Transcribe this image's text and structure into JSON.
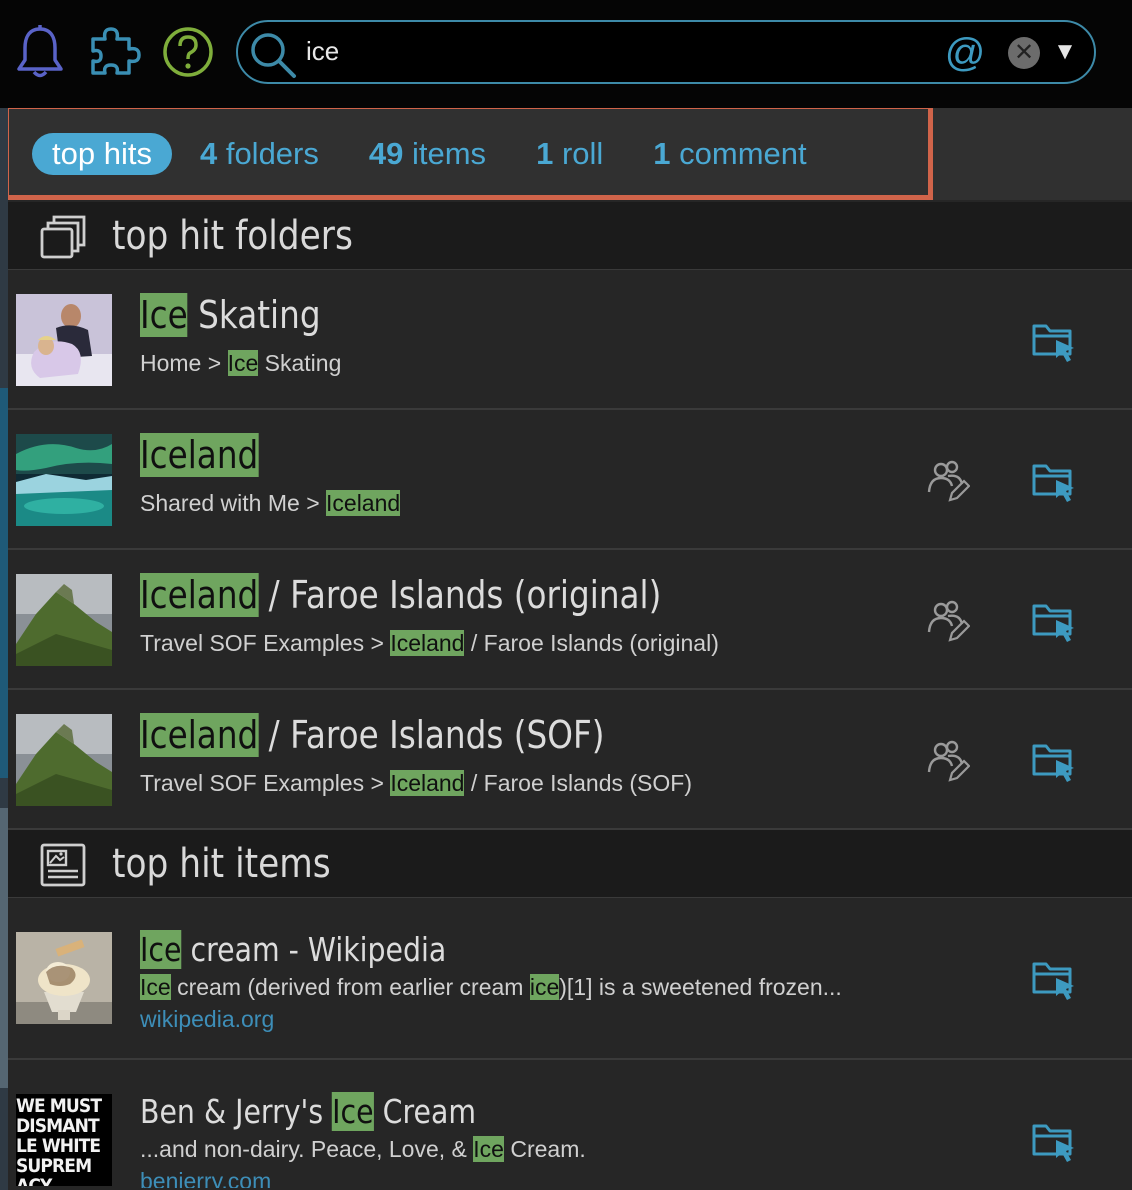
{
  "toolbar": {
    "icons": [
      "bell-icon",
      "puzzle-icon",
      "help-icon"
    ],
    "search": {
      "query": "ice",
      "at_symbol": "@",
      "clear_symbol": "✕",
      "dropdown_symbol": "▼"
    },
    "accent": "#3d8aa8"
  },
  "filters": [
    {
      "label": "top hits",
      "count": "",
      "active": true
    },
    {
      "count": "4",
      "label": "folders",
      "active": false
    },
    {
      "count": "49",
      "label": "items",
      "active": false
    },
    {
      "count": "1",
      "label": "roll",
      "active": false
    },
    {
      "count": "1",
      "label": "comment",
      "active": false
    }
  ],
  "sections": {
    "folders": {
      "title": "top hit folders",
      "icon": "folders-icon"
    },
    "items": {
      "title": "top hit items",
      "icon": "image-item-icon"
    }
  },
  "folders": [
    {
      "title_hl": "Ice",
      "title_rest": " Skating",
      "path_pre": "Home > ",
      "path_hl": "Ice",
      "path_post": " Skating",
      "shared": false
    },
    {
      "title_hl": "Iceland",
      "title_rest": "",
      "path_pre": "Shared with Me > ",
      "path_hl": "Iceland",
      "path_post": "",
      "shared": true
    },
    {
      "title_hl": "Iceland",
      "title_rest": " / Faroe Islands (original)",
      "path_pre": "Travel SOF Examples > ",
      "path_hl": "Iceland",
      "path_post": " / Faroe Islands (original)",
      "shared": true
    },
    {
      "title_hl": "Iceland",
      "title_rest": " / Faroe Islands (SOF)",
      "path_pre": "Travel SOF Examples > ",
      "path_hl": "Iceland",
      "path_post": " / Faroe Islands (SOF)",
      "shared": true
    }
  ],
  "items": [
    {
      "title_pre": "",
      "title_hl": "Ice",
      "title_post": " cream - Wikipedia",
      "snip_a_hl": "Ice",
      "snip_b": " cream (derived from earlier cream ",
      "snip_c_hl": "ice",
      "snip_d": ")[1] is a sweetened frozen...",
      "link": "wikipedia.org",
      "thumb_text": ""
    },
    {
      "title_pre": "Ben & Jerry's ",
      "title_hl": "Ice",
      "title_post": " Cream",
      "snip_a_hl": "",
      "snip_b": "...and non-dairy. Peace, Love, & ",
      "snip_c_hl": "Ice",
      "snip_d": " Cream.",
      "link": "benjerry.com",
      "thumb_text": "WE MUST DISMANTLE WHITE SUPREMACY"
    }
  ],
  "colors": {
    "highlight": "#6fa55f",
    "link": "#3d8eb8",
    "tab": "#4aa8d3",
    "outline": "#d0644a"
  }
}
